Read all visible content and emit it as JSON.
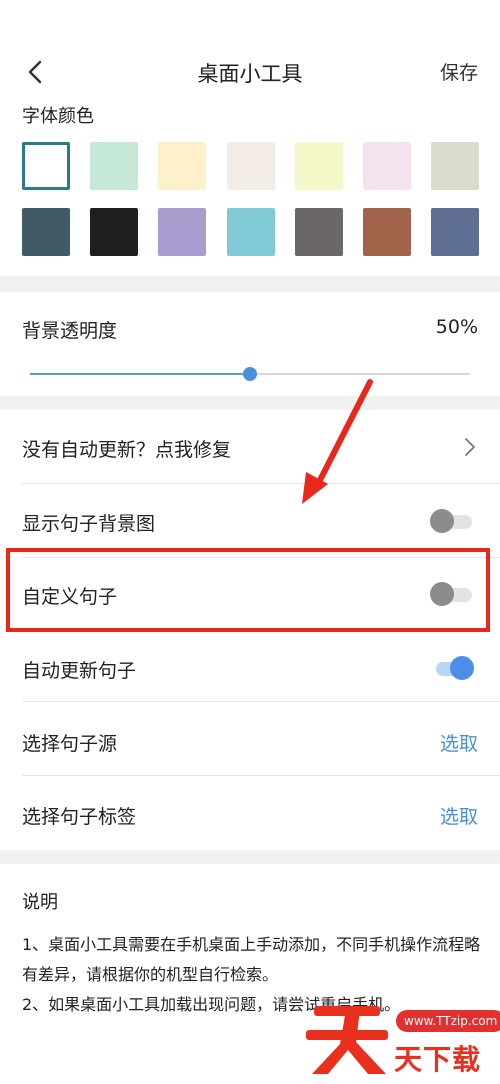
{
  "header": {
    "title": "桌面小工具",
    "save_label": "保存",
    "back_icon": "chevron-left-icon"
  },
  "font_color": {
    "label": "字体颜色",
    "swatches": [
      "#ffffff",
      "#c6e8d6",
      "#fdf1cc",
      "#f3ebe6",
      "#f4f8c9",
      "#f4e2ee",
      "#d9dccb",
      "#3f5c66",
      "#1f1f1f",
      "#a99cce",
      "#7fcad4",
      "#6b6668",
      "#a3634b",
      "#5f6f94"
    ],
    "selected_index": 0,
    "selected_color": "#2a7a8c"
  },
  "opacity": {
    "label": "背景透明度",
    "value_text": "50%",
    "value": 0.5,
    "accent": "#4b8fd6"
  },
  "rows": {
    "fix": {
      "label": "没有自动更新？点我修复",
      "icon": "chevron-right-icon"
    },
    "show_bg": {
      "label": "显示句子背景图",
      "on": false
    },
    "custom": {
      "label": "自定义句子",
      "on": false
    },
    "auto_update": {
      "label": "自动更新句子",
      "on": true
    },
    "source": {
      "label": "选择句子源",
      "action": "选取"
    },
    "tags": {
      "label": "选择句子标签",
      "action": "选取"
    }
  },
  "notes": {
    "title": "说明",
    "line1": "1、桌面小工具需要在手机桌面上手动添加，不同手机操作流程略有差异，请根据你的机型自行检索。",
    "line2": "2、如果桌面小工具加载出现问题，请尝试重启手机。"
  },
  "annotation": {
    "highlight_color": "#e8281c"
  },
  "watermark": {
    "url": "www.TTzip.com",
    "text": "天下载"
  }
}
